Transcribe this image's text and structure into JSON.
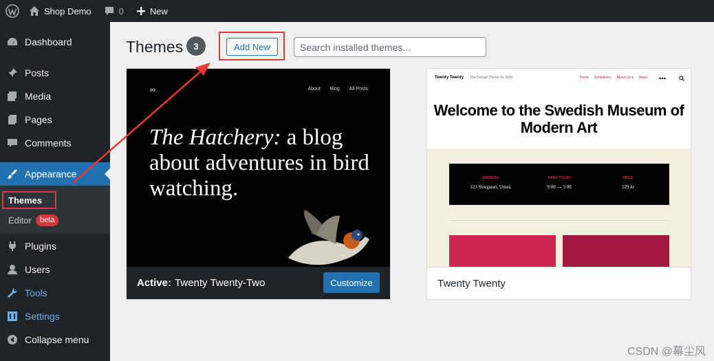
{
  "adminbar": {
    "site_name": "Shop Demo",
    "comments_count": "0",
    "new_label": "New"
  },
  "sidebar": {
    "items": [
      {
        "label": "Dashboard",
        "icon": "dashboard-icon"
      },
      {
        "label": "Posts",
        "icon": "pin-icon"
      },
      {
        "label": "Media",
        "icon": "media-icon"
      },
      {
        "label": "Pages",
        "icon": "pages-icon"
      },
      {
        "label": "Comments",
        "icon": "comment-icon"
      },
      {
        "label": "Appearance",
        "icon": "brush-icon"
      },
      {
        "label": "Plugins",
        "icon": "plug-icon"
      },
      {
        "label": "Users",
        "icon": "user-icon"
      },
      {
        "label": "Tools",
        "icon": "wrench-icon"
      },
      {
        "label": "Settings",
        "icon": "settings-icon"
      },
      {
        "label": "Collapse menu",
        "icon": "collapse-icon"
      }
    ],
    "submenu": {
      "themes": "Themes",
      "editor": "Editor",
      "beta": "beta"
    }
  },
  "header": {
    "title": "Themes",
    "count": "3",
    "add_new": "Add New",
    "search_placeholder": "Search installed themes..."
  },
  "themes": [
    {
      "active_prefix": "Active:",
      "name": "Twenty Twenty-Two",
      "customize": "Customize",
      "screenshot": {
        "logo": "∞",
        "nav": [
          "About",
          "Blog",
          "All Posts"
        ],
        "headline_italic": "The Hatchery:",
        "headline_rest": " a blog about adventures in bird watching."
      }
    },
    {
      "name": "Twenty Twenty",
      "screenshot": {
        "site_name": "Twenty Twenty",
        "tagline": "The Default Theme for 2020",
        "nav": [
          "Home",
          "Exhibitions",
          "About Us ▾",
          "News"
        ],
        "title": "Welcome to the Swedish Museum of Modern Art",
        "info": [
          {
            "label": "ADDRESS",
            "value": "123 Storgatan, Umeå"
          },
          {
            "label": "OPEN TODAY",
            "value": "9:00 — 5:00"
          },
          {
            "label": "PRICE",
            "value": "129 kr"
          }
        ]
      }
    }
  ],
  "watermark": "CSDN @幕尘风",
  "colors": {
    "admin_dark": "#1d2327",
    "accent_blue": "#2271b1",
    "highlight_red": "#e53935"
  }
}
